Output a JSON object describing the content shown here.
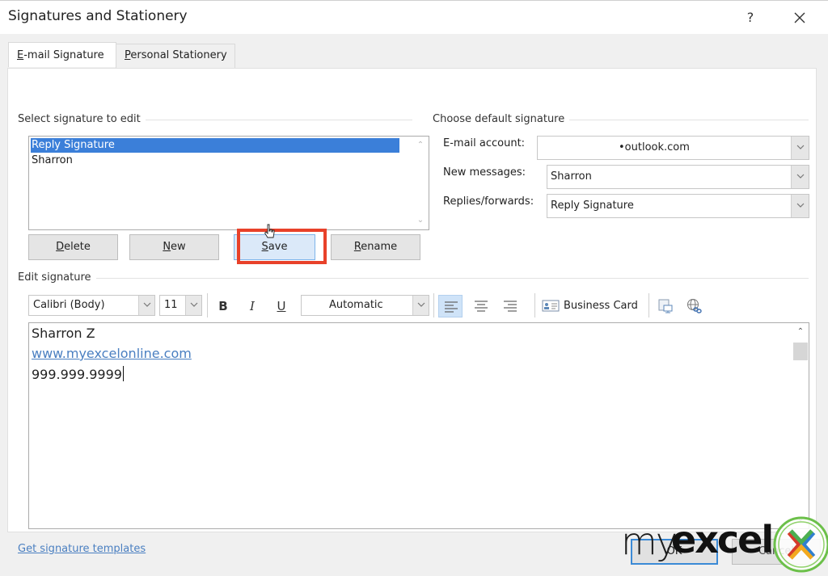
{
  "window": {
    "title": "Signatures and Stationery",
    "help_label": "?",
    "close_icon": "close-icon"
  },
  "tabs": [
    {
      "label_u": "E",
      "label_rest": "-mail Signature",
      "active": true
    },
    {
      "label_u": "P",
      "label_rest": "ersonal Stationery",
      "active": false
    }
  ],
  "select_signature": {
    "label": "Select signature to edit",
    "items": [
      "Reply Signature",
      "Sharron"
    ],
    "selected_index": 0,
    "buttons": {
      "delete": "Delete",
      "new": "New",
      "save": "Save",
      "rename": "Rename"
    }
  },
  "default_signature": {
    "label": "Choose default signature",
    "email_account_label": "E-mail account:",
    "email_account_value": "outlook.com",
    "new_messages_label": "New messages:",
    "new_messages_value": "Sharron",
    "replies_label": "Replies/forwards:",
    "replies_value": "Reply Signature"
  },
  "edit_signature": {
    "label": "Edit signature",
    "toolbar": {
      "font": "Calibri (Body)",
      "size": "11",
      "bold": "B",
      "italic": "I",
      "underline": "U",
      "color": "Automatic",
      "business_card": "Business Card"
    },
    "content": [
      {
        "text": "Sharron Z",
        "type": "text"
      },
      {
        "text": "www.myexcelonline.com",
        "type": "link"
      },
      {
        "text": "999.999.9999",
        "type": "text"
      }
    ]
  },
  "footer": {
    "templates_link": "Get signature templates",
    "ok": "OK",
    "cancel": "Cancel"
  },
  "watermark": {
    "my": "my",
    "excel": "excel"
  },
  "colors": {
    "selection": "#3b7fd9",
    "highlight_box": "#e8412a",
    "link": "#4a7fc1"
  }
}
